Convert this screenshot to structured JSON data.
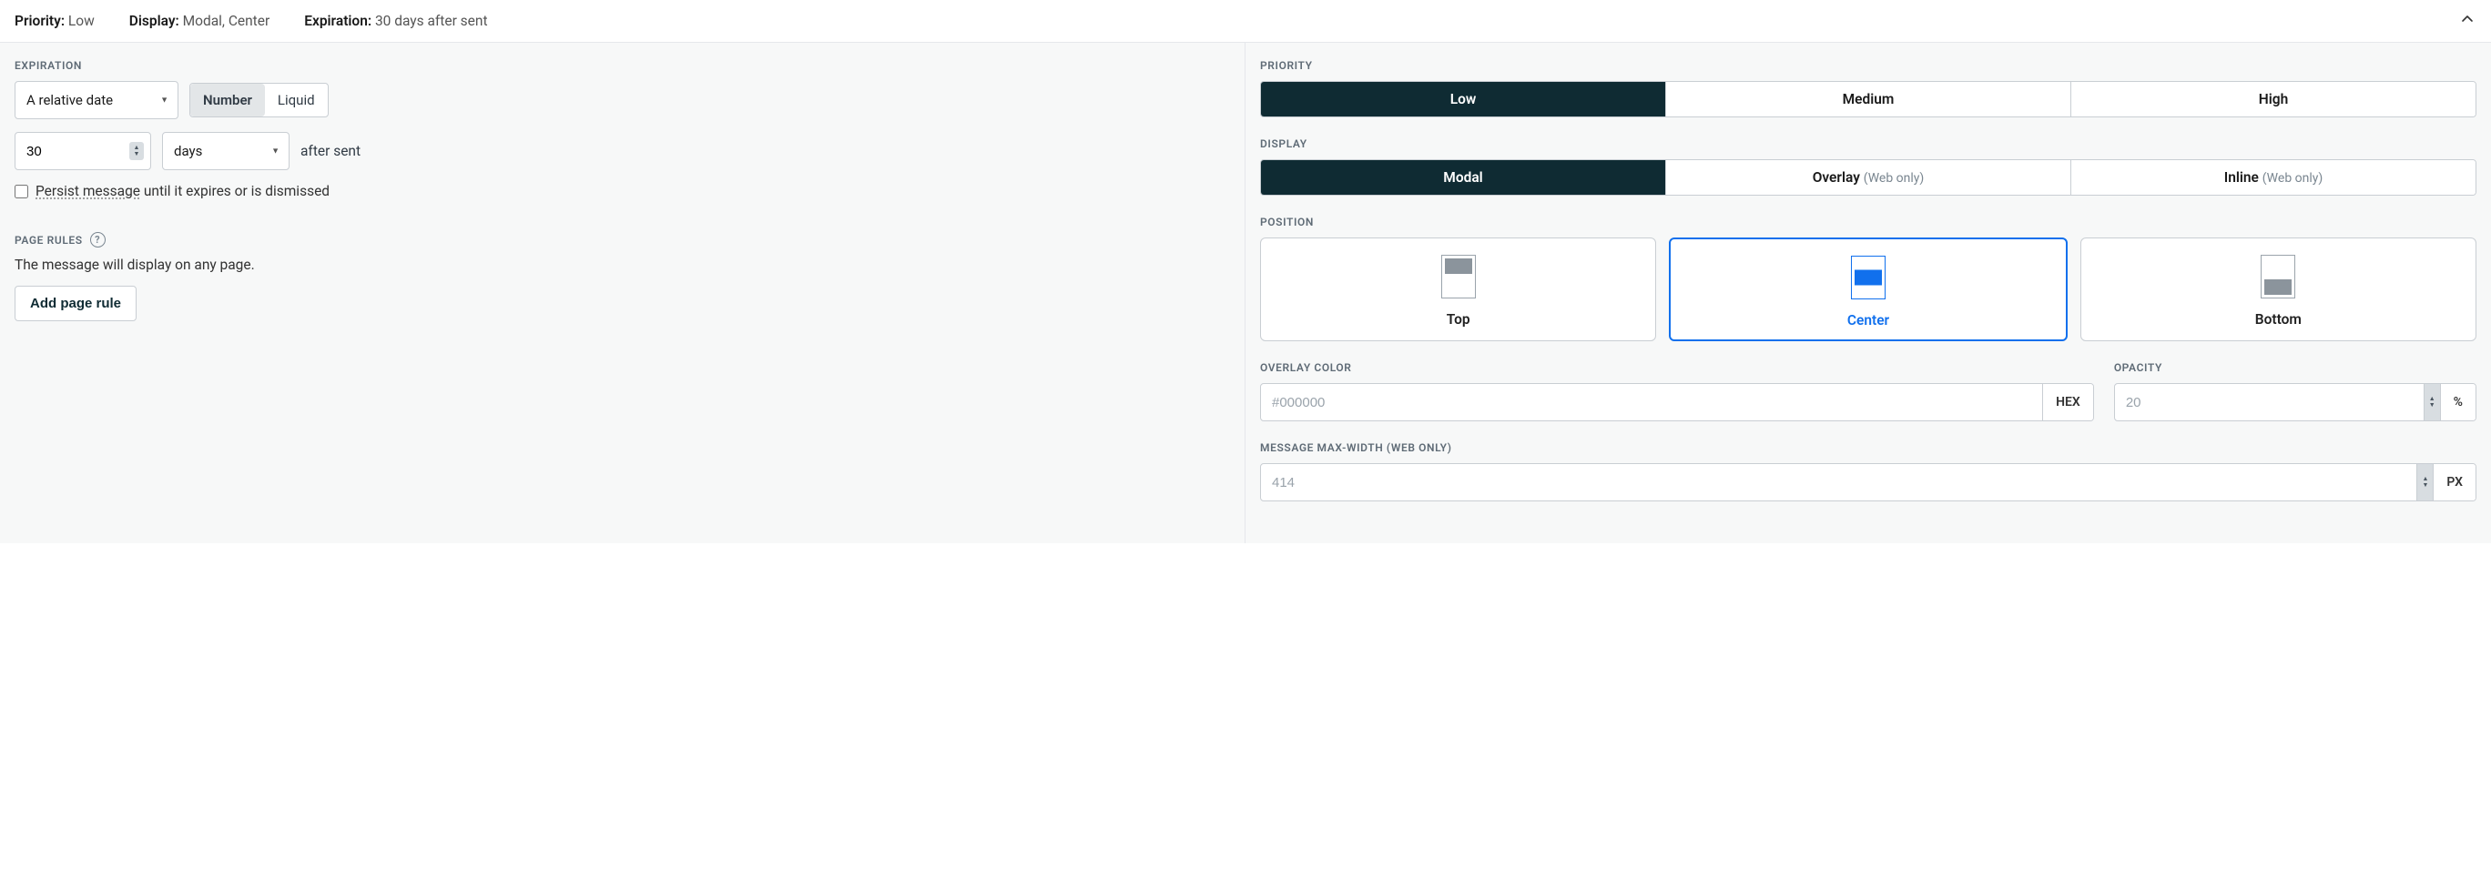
{
  "summary": {
    "priority_label": "Priority:",
    "priority_value": "Low",
    "display_label": "Display:",
    "display_value": "Modal, Center",
    "expiration_label": "Expiration:",
    "expiration_value": "30 days after sent"
  },
  "expiration": {
    "section_label": "EXPIRATION",
    "type_select": "A relative date",
    "format_options": {
      "number": "Number",
      "liquid": "Liquid"
    },
    "amount": "30",
    "unit": "days",
    "after_text": "after sent",
    "persist_label_underline": "Persist message",
    "persist_label_rest": " until it expires or is dismissed"
  },
  "page_rules": {
    "section_label": "PAGE RULES",
    "description": "The message will display on any page.",
    "add_button": "Add page rule"
  },
  "priority": {
    "section_label": "PRIORITY",
    "options": {
      "low": "Low",
      "medium": "Medium",
      "high": "High"
    }
  },
  "display": {
    "section_label": "DISPLAY",
    "options": {
      "modal": "Modal",
      "overlay": "Overlay",
      "overlay_hint": "(Web only)",
      "inline": "Inline",
      "inline_hint": "(Web only)"
    }
  },
  "position": {
    "section_label": "POSITION",
    "options": {
      "top": "Top",
      "center": "Center",
      "bottom": "Bottom"
    }
  },
  "overlay_color": {
    "section_label": "OVERLAY COLOR",
    "placeholder": "#000000",
    "suffix": "HEX"
  },
  "opacity": {
    "section_label": "OPACITY",
    "placeholder": "20",
    "suffix": "%"
  },
  "max_width": {
    "section_label": "MESSAGE MAX-WIDTH (WEB ONLY)",
    "placeholder": "414",
    "suffix": "PX"
  }
}
